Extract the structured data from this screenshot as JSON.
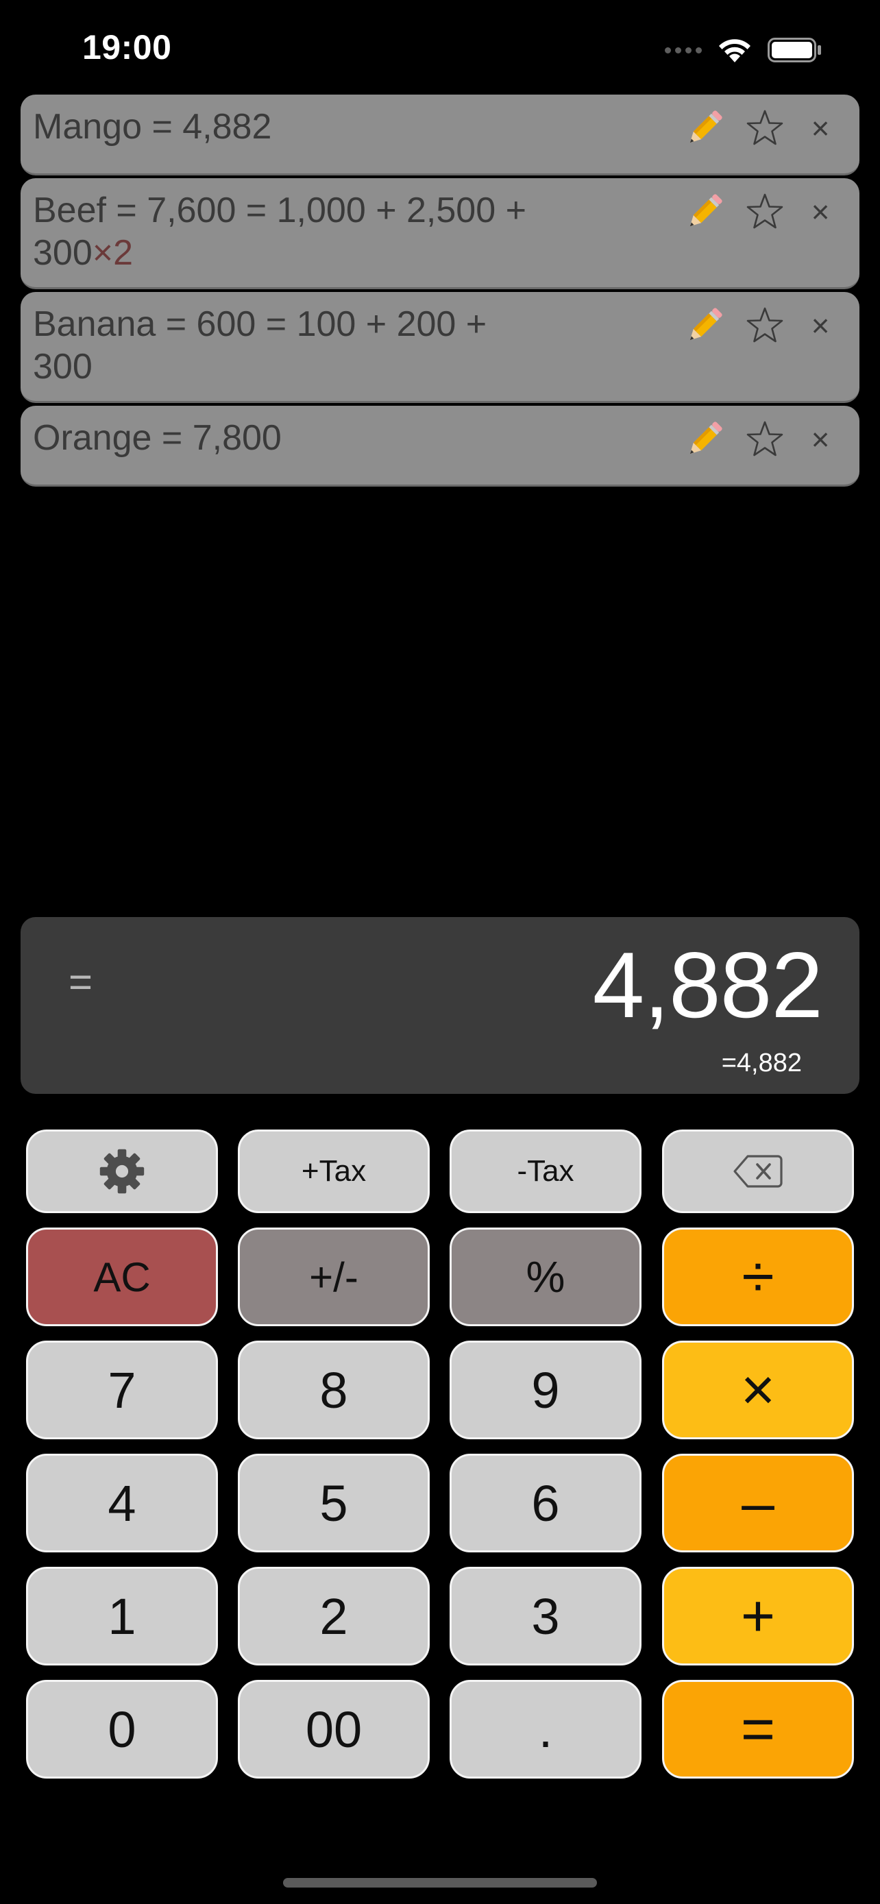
{
  "status_bar": {
    "time": "19:00"
  },
  "history": [
    {
      "line1": "Mango = 4,882",
      "line2": "",
      "mult": ""
    },
    {
      "line1": "Beef = 7,600 = 1,000 + 2,500 +",
      "line2": "300",
      "mult": "×2"
    },
    {
      "line1": "Banana = 600 = 100 + 200 +",
      "line2": "300",
      "mult": ""
    },
    {
      "line1": "Orange = 7,800",
      "line2": "",
      "mult": ""
    }
  ],
  "history_actions": {
    "close_glyph": "×"
  },
  "display": {
    "operator": "=",
    "value": "4,882",
    "sub": "=4,882"
  },
  "keys": {
    "plus_tax": "+Tax",
    "minus_tax": "-Tax",
    "ac": "AC",
    "sign": "+/-",
    "percent": "%",
    "divide": "÷",
    "seven": "7",
    "eight": "8",
    "nine": "9",
    "multiply": "×",
    "four": "4",
    "five": "5",
    "six": "6",
    "minus": "–",
    "one": "1",
    "two": "2",
    "three": "3",
    "plus": "+",
    "zero": "0",
    "double_zero": "00",
    "dot": ".",
    "equals": "="
  },
  "icons": {
    "settings": "gear-icon",
    "backspace": "backspace-icon",
    "edit": "pencil-icon",
    "favorite": "star-icon",
    "delete": "close-icon"
  },
  "colors": {
    "operator_orange": "#fba405",
    "operator_yellow": "#fdbd15",
    "clear_red": "#a85050",
    "function_gray": "#8c8585",
    "digit_gray": "#cecece",
    "history_bg": "#8e8e8e",
    "display_bg": "#3b3b3b"
  }
}
